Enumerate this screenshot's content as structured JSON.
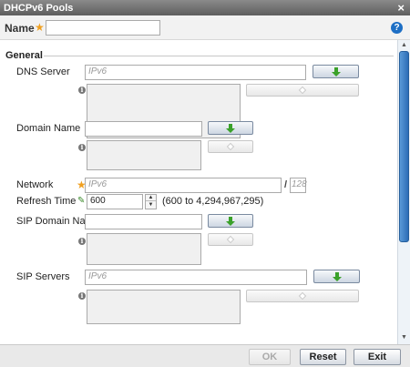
{
  "window": {
    "title": "DHCPv6 Pools",
    "close_glyph": "×"
  },
  "header": {
    "name_label": "Name",
    "required_mark": "★",
    "name_value": "",
    "help_glyph": "?"
  },
  "general": {
    "section_title": "General",
    "dns_server": {
      "label": "DNS Server",
      "placeholder": "IPv6"
    },
    "domain_name": {
      "label": "Domain Name",
      "value": ""
    },
    "network": {
      "label": "Network",
      "placeholder": "IPv6",
      "prefix_sep": "/",
      "prefix_placeholder": "128"
    },
    "refresh_time": {
      "label": "Refresh Time",
      "value": "600",
      "range": "(600 to 4,294,967,295)"
    },
    "sip_domain_name": {
      "label": "SIP Domain Name",
      "value": ""
    },
    "sip_servers": {
      "label": "SIP Servers",
      "placeholder": "IPv6"
    }
  },
  "footer": {
    "ok_label": "OK",
    "reset_label": "Reset",
    "exit_label": "Exit"
  },
  "colors": {
    "title_bar": "#6e6e6e",
    "add_arrow": "#3aa12a",
    "required_star": "#f0a020",
    "help": "#1e6fc5",
    "scroll_thumb": "#3b7ec4"
  }
}
